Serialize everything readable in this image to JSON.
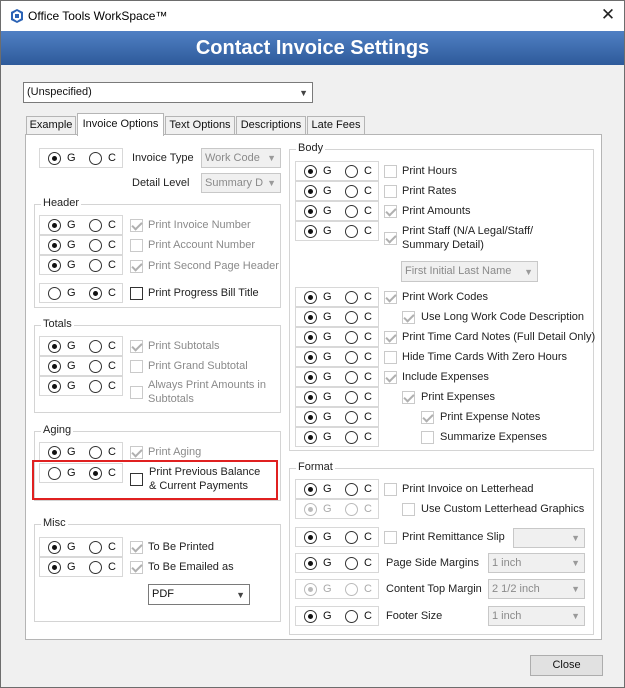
{
  "window": {
    "title": "Office Tools WorkSpace™",
    "close_glyph": "✕"
  },
  "header": {
    "title": "Contact Invoice Settings"
  },
  "contact_select": {
    "value": "(Unspecified)"
  },
  "tabs": [
    {
      "label": "Example"
    },
    {
      "label": "Invoice Options"
    },
    {
      "label": "Text Options"
    },
    {
      "label": "Descriptions"
    },
    {
      "label": "Late Fees"
    }
  ],
  "gc": {
    "g": "G",
    "c": "C"
  },
  "top": {
    "invoice_type_label": "Invoice Type",
    "invoice_type_value": "Work Code",
    "detail_level_label": "Detail Level",
    "detail_level_value": "Summary D"
  },
  "header_group": {
    "title": "Header",
    "items": [
      "Print Invoice Number",
      "Print Account Number",
      "Print Second Page Header",
      "Print Progress Bill Title"
    ]
  },
  "totals_group": {
    "title": "Totals",
    "items": [
      "Print Subtotals",
      "Print Grand Subtotal",
      "Always Print Amounts in",
      "Subtotals"
    ]
  },
  "aging_group": {
    "title": "Aging",
    "items": [
      "Print Aging",
      "Print Previous Balance",
      "& Current Payments"
    ]
  },
  "misc_group": {
    "title": "Misc",
    "items": [
      "To Be Printed",
      "To Be Emailed as"
    ],
    "email_format": "PDF"
  },
  "body_group": {
    "title": "Body",
    "items": [
      "Print Hours",
      "Print Rates",
      "Print Amounts",
      "Print Staff (N/A Legal/Staff/",
      "Summary Detail)",
      "Print Work Codes",
      "Use Long Work Code Description",
      "Print Time Card Notes (Full Detail Only)",
      "Hide Time Cards With Zero Hours",
      "Include Expenses",
      "Print Expenses",
      "Print Expense Notes",
      "Summarize Expenses"
    ],
    "staff_name_format": "First Initial Last Name"
  },
  "format_group": {
    "title": "Format",
    "items": [
      "Print Invoice on Letterhead",
      "Use Custom Letterhead Graphics",
      "Print Remittance Slip"
    ],
    "page_side_margins_label": "Page Side Margins",
    "page_side_margins_value": "1 inch",
    "content_top_margin_label": "Content Top Margin",
    "content_top_margin_value": "2 1/2 inch",
    "footer_size_label": "Footer Size",
    "footer_size_value": "1 inch"
  },
  "footer": {
    "close_label": "Close"
  },
  "colors": {
    "banner": "#3a6db5",
    "highlight": "#e02020"
  }
}
